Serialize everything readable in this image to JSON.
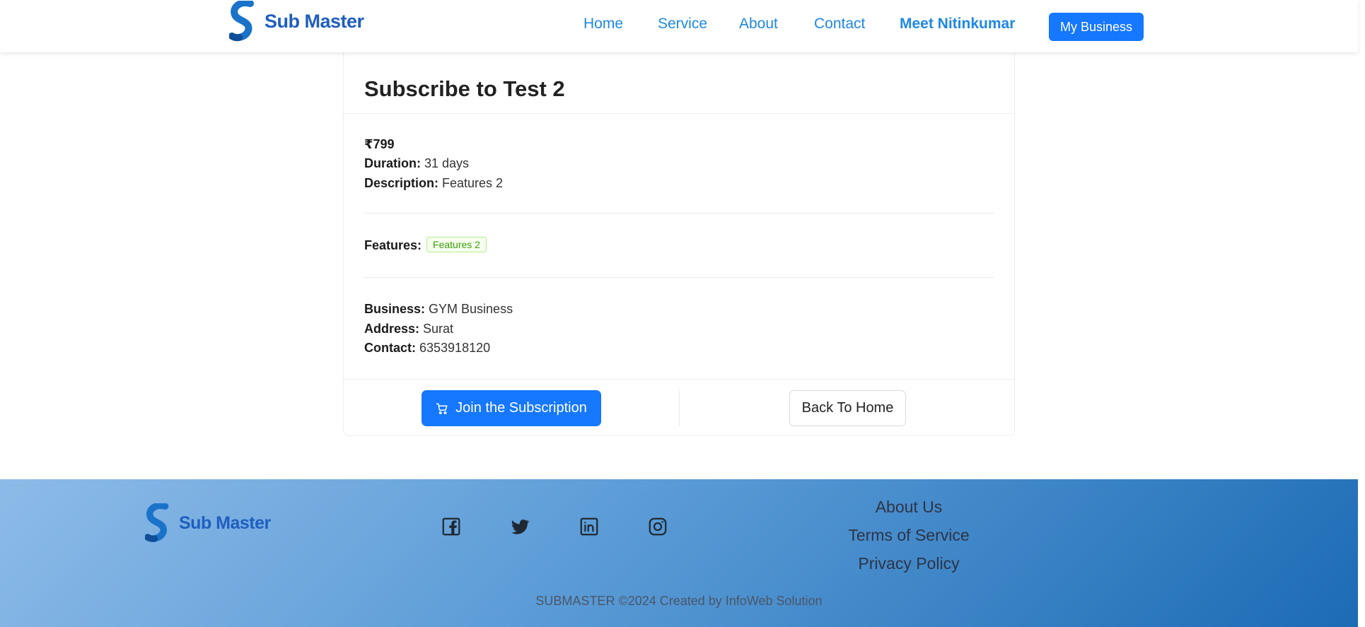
{
  "brand": {
    "name": "Sub Master"
  },
  "nav": {
    "links": [
      {
        "label": "Home"
      },
      {
        "label": "Service"
      },
      {
        "label": "About"
      },
      {
        "label": "Contact"
      },
      {
        "label": "Meet Nitinkumar"
      }
    ],
    "cta_label": "My Business"
  },
  "plan": {
    "title": "Subscribe to Test 2",
    "price": "₹799",
    "duration_label": "Duration:",
    "duration_value": " 31 days",
    "description_label": "Description:",
    "description_value": " Features 2",
    "features_label": "Features:",
    "features": [
      "Features 2"
    ],
    "business_label": "Business:",
    "business_value": " GYM Business",
    "address_label": "Address:",
    "address_value": " Surat",
    "contact_label": "Contact:",
    "contact_value": " 6353918120",
    "join_label": "Join the Subscription",
    "back_label": "Back To Home"
  },
  "footer": {
    "brand": "Sub Master",
    "social_icons": [
      "facebook-icon",
      "twitter-icon",
      "linkedin-icon",
      "instagram-icon"
    ],
    "links": [
      "About Us",
      "Terms of Service",
      "Privacy Policy"
    ],
    "copyright": "SUBMASTER ©2024 Created by InfoWeb Solution"
  },
  "colors": {
    "primary": "#1677ff",
    "nav_link": "#1e88e5",
    "brand": "#1f5fbf",
    "tag_green": "#389e0d"
  }
}
